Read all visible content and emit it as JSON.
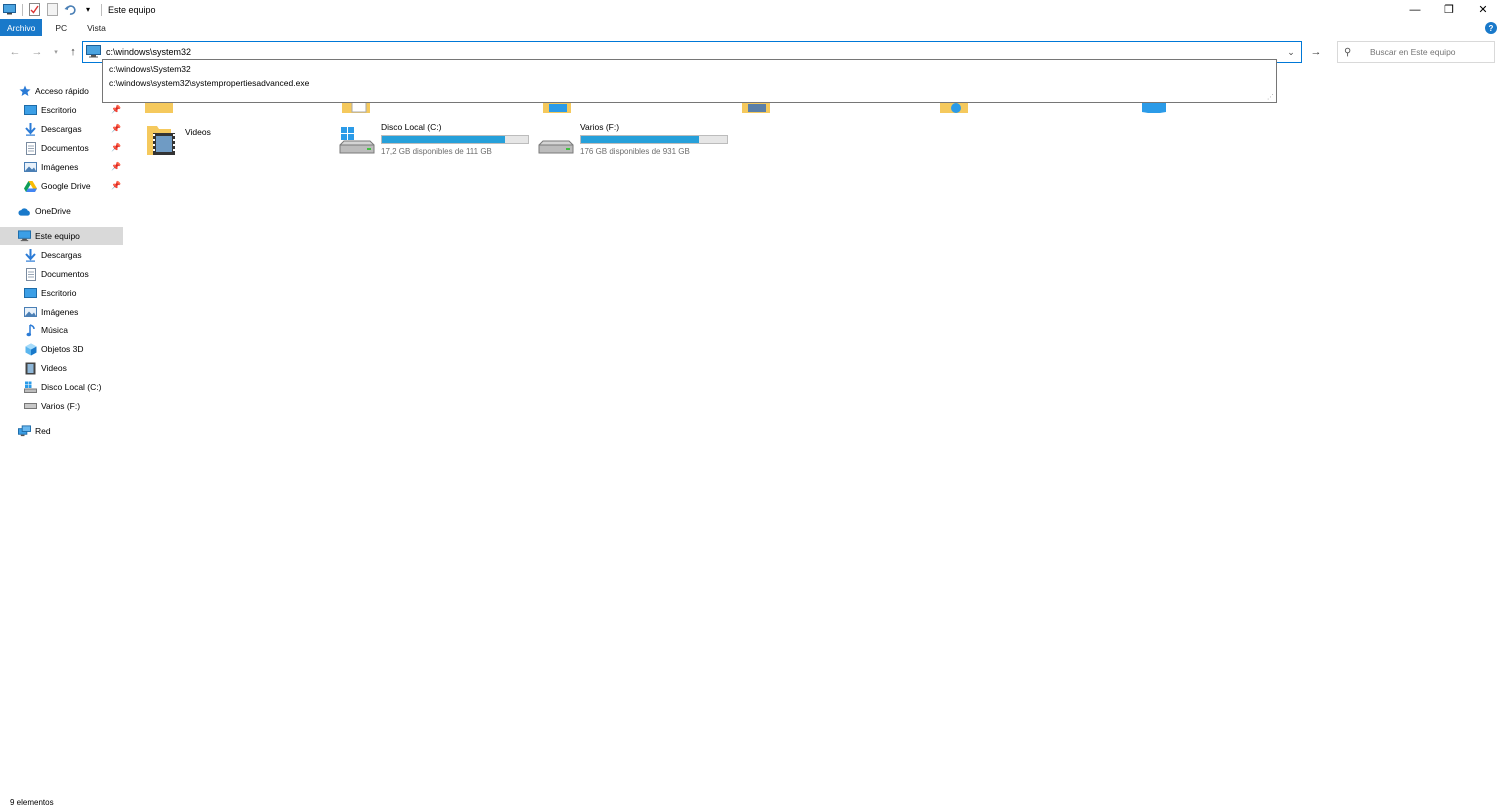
{
  "window": {
    "title": "Este equipo",
    "controls": {
      "minimize": "—",
      "maximize": "❐",
      "close": "✕"
    }
  },
  "ribbon": {
    "tabs": [
      "Archivo",
      "PC",
      "Vista"
    ],
    "help": "?"
  },
  "nav": {
    "back": "←",
    "forward": "→",
    "up": "↑",
    "address_value": "c:\\windows\\system32",
    "go": "→",
    "search_placeholder": "Buscar en Este equipo"
  },
  "suggestions": [
    "c:\\windows\\System32",
    "c:\\windows\\system32\\systempropertiesadvanced.exe"
  ],
  "sidebar": {
    "quick_access": "Acceso rápido",
    "quick_items": [
      "Escritorio",
      "Descargas",
      "Documentos",
      "Imágenes",
      "Google Drive"
    ],
    "onedrive": "OneDrive",
    "this_pc": "Este equipo",
    "pc_items": [
      "Descargas",
      "Documentos",
      "Escritorio",
      "Imágenes",
      "Música",
      "Objetos 3D",
      "Videos",
      "Disco Local (C:)",
      "Varios (F:)"
    ],
    "network": "Red"
  },
  "content": {
    "folders": [
      {
        "name": "Videos"
      }
    ],
    "drives": [
      {
        "name": "Disco Local (C:)",
        "free": "17,2 GB disponibles de 111 GB",
        "used_fraction": 0.845
      },
      {
        "name": "Varios (F:)",
        "free": "176 GB disponibles de 931 GB",
        "used_fraction": 0.811
      }
    ]
  },
  "status": {
    "count": "9 elementos"
  },
  "colors": {
    "accent": "#1979ca",
    "address_border": "#0078d7",
    "drive_bar": "#26a0da"
  }
}
